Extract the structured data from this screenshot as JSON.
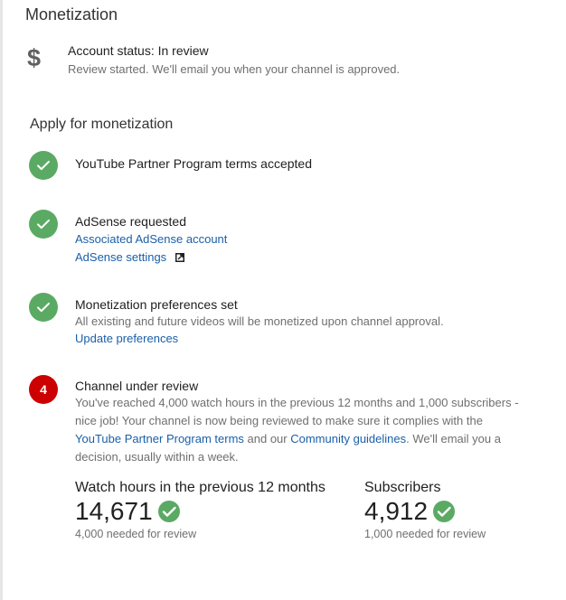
{
  "page": {
    "title": "Monetization"
  },
  "account_status": {
    "icon": "dollar-icon",
    "glyph": "$",
    "title": "Account status: In review",
    "subtitle": "Review started. We'll email you when your channel is approved."
  },
  "apply": {
    "title": "Apply for monetization",
    "steps": [
      {
        "state": "done",
        "title": "YouTube Partner Program terms accepted"
      },
      {
        "state": "done",
        "title": "AdSense requested",
        "link1": "Associated AdSense account",
        "link2": "AdSense settings"
      },
      {
        "state": "done",
        "title": "Monetization preferences set",
        "subtitle": "All existing and future videos will be monetized upon channel approval.",
        "link1": "Update preferences"
      },
      {
        "state": "pending",
        "number": "4",
        "title": "Channel under review",
        "para_1": "You've reached 4,000 watch hours in the previous 12 months and 1,000 subscribers - nice job! Your channel is now being reviewed to make sure it complies with the ",
        "link_terms": "YouTube Partner Program terms",
        "para_2": " and our ",
        "link_guidelines": "Community guidelines",
        "para_3": ". We'll email you a decision, usually within a week."
      }
    ]
  },
  "metrics": {
    "watch_hours": {
      "label": "Watch hours in the previous 12 months",
      "value": "14,671",
      "sub": "4,000 needed for review"
    },
    "subscribers": {
      "label": "Subscribers",
      "value": "4,912",
      "sub": "1,000 needed for review"
    }
  },
  "colors": {
    "success": "#5aaa64",
    "alert": "#cc0000",
    "link": "#1a5fa8"
  }
}
